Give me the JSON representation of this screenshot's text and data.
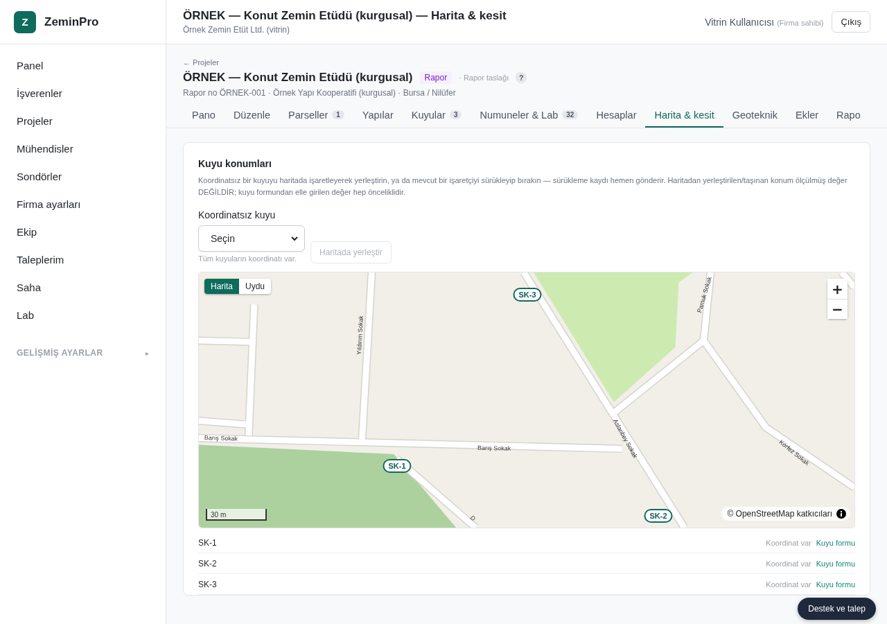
{
  "brand": {
    "logo_letter": "Z",
    "name": "ZeminPro"
  },
  "sidebar": {
    "items": [
      {
        "label": "Panel",
        "selected": false
      },
      {
        "label": "İşverenler",
        "selected": false
      },
      {
        "label": "Projeler",
        "selected": false
      },
      {
        "label": "Mühendisler",
        "selected": false
      },
      {
        "label": "Sondörler",
        "selected": false
      },
      {
        "label": "Firma ayarları",
        "selected": false
      },
      {
        "label": "Ekip",
        "selected": false
      },
      {
        "label": "Taleplerim",
        "selected": false
      },
      {
        "label": "Saha",
        "selected": false
      },
      {
        "label": "Lab",
        "selected": false
      }
    ],
    "advanced": {
      "label": "GELİŞMİŞ AYARLAR",
      "toggle": "▸",
      "expanded": false
    }
  },
  "header": {
    "title": "ÖRNEK — Konut Zemin Etüdü (kurgusal) — Harita & kesit",
    "subtitle": "Örnek Zemin Etüt Ltd. (vitrin)",
    "user": "Vitrin Kullanıcısı",
    "role": "(Firma sahibi)",
    "logout": "Çıkış"
  },
  "project": {
    "back": "← Projeler",
    "title": "ÖRNEK — Konut Zemin Etüdü (kurgusal)",
    "badge": "Rapor",
    "status": "· Rapor taslağı",
    "help": "?",
    "meta": "Rapor no ÖRNEK-001 · Örnek Yapı Kooperatifi (kurgusal) · Bursa / Nilüfer"
  },
  "tabs": [
    {
      "label": "Pano",
      "selected": false
    },
    {
      "label": "Düzenle",
      "selected": false
    },
    {
      "label": "Parseller",
      "count": "1",
      "selected": false
    },
    {
      "label": "Yapılar",
      "selected": false
    },
    {
      "label": "Kuyular",
      "count": "3",
      "selected": false
    },
    {
      "label": "Numuneler & Lab",
      "count": "32",
      "selected": false
    },
    {
      "label": "Hesaplar",
      "selected": false
    },
    {
      "label": "Harita & kesit",
      "selected": true
    },
    {
      "label": "Geoteknik",
      "selected": false
    },
    {
      "label": "Ekler",
      "selected": false
    },
    {
      "label": "Rapo",
      "selected": false
    }
  ],
  "card": {
    "title": "Kuyu konumları",
    "description": "Koordinatsız bir kuyuyu haritada işaretleyerek yerleştirin, ya da mevcut bir işaretçiyi sürükleyip bırakın — sürükleme kaydı hemen gönderir. Haritadan yerleştirilen/taşınan konum ölçülmüş değer DEĞİLDİR; kuyu formundan elle girilen değer hep önceliklidir.",
    "field_label": "Koordinatsız kuyu",
    "select_value": "Seçin",
    "hint": "Tüm kuyuların koordinatı var.",
    "place_button": {
      "label": "Haritada yerleştir",
      "disabled": true
    }
  },
  "map": {
    "layers": [
      {
        "label": "Harita",
        "selected": true
      },
      {
        "label": "Uydu",
        "selected": false
      }
    ],
    "zoom_in": "+",
    "zoom_out": "−",
    "street_labels": [
      "Yıldırım Sokak",
      "Barış Sokak",
      "Barış Sokak",
      "Aslanbey Sokak",
      "Pamuk Sokak",
      "Körfez Sokak",
      "D"
    ],
    "markers": [
      {
        "label": "SK-3"
      },
      {
        "label": "SK-1"
      },
      {
        "label": "SK-2"
      }
    ],
    "scale": "30 m",
    "attribution": "© OpenStreetMap katkıcıları"
  },
  "wells": [
    {
      "name": "SK-1",
      "status": "Koordinat var",
      "link": "Kuyu formu"
    },
    {
      "name": "SK-2",
      "status": "Koordinat var",
      "link": "Kuyu formu"
    },
    {
      "name": "SK-3",
      "status": "Koordinat var",
      "link": "Kuyu formu"
    }
  ],
  "support_button": "Destek ve talep"
}
